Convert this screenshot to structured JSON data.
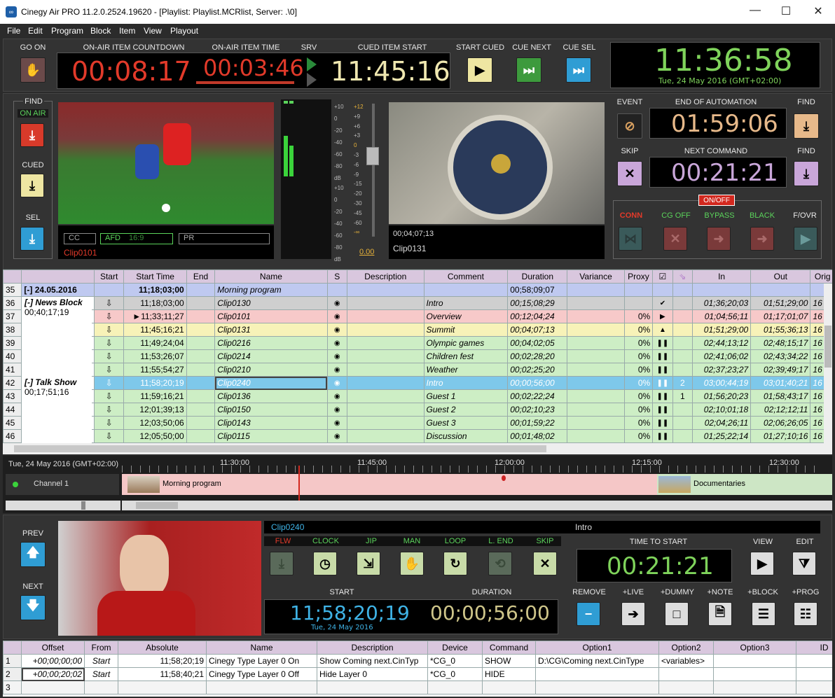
{
  "window": {
    "title": "Cinegy Air PRO 11.2.0.2524.19620 - [Playlist: Playlist.MCRlist, Server: .\\0]",
    "minimize": "—",
    "maximize": "☐",
    "close": "✕"
  },
  "menu": [
    "File",
    "Edit",
    "Program",
    "Block",
    "Item",
    "View",
    "Playout"
  ],
  "top": {
    "go_on": "GO ON",
    "countdown_label": "ON-AIR ITEM COUNTDOWN",
    "countdown": "00:08:17",
    "item_time_label": "ON-AIR ITEM TIME",
    "item_time": "00:03:46",
    "srv_label": "SRV",
    "cued_start_label": "CUED ITEM START",
    "cued_start": "11:45:16",
    "start_cued": "START CUED",
    "cue_next": "CUE NEXT",
    "cue_sel": "CUE SEL",
    "clock": "11:36:58",
    "date": "Tue, 24 May 2016 (GMT+02:00)"
  },
  "find": {
    "title": "FIND",
    "on_air": "ON AIR",
    "cued": "CUED",
    "sel": "SEL"
  },
  "preview": {
    "cc": "CC",
    "afd": "AFD",
    "afd_val": "16:9",
    "pr": "PR",
    "clip": "Clip0101"
  },
  "audio": {
    "scale": [
      "+10",
      "0",
      "-20",
      "-40",
      "-60",
      "-80",
      "dB"
    ],
    "scale2": [
      "+10",
      "0",
      "-20",
      "-40",
      "-60",
      "-80",
      "dB"
    ],
    "fader": [
      "+12",
      "+9",
      "+6",
      "+3",
      "0",
      "-3",
      "-6",
      "-9",
      "-15",
      "-20",
      "-30",
      "-45",
      "-60",
      "-∞"
    ],
    "gain": "0.00"
  },
  "program": {
    "tc": "00;04;07;13",
    "clip": "Clip0131"
  },
  "event": {
    "event_label": "EVENT",
    "eoa_label": "END OF AUTOMATION",
    "eoa": "01:59:06",
    "find1": "FIND",
    "skip_label": "SKIP",
    "next_cmd_label": "NEXT COMMAND",
    "next_cmd": "00:21:21",
    "find2": "FIND",
    "onoff": "ON/OFF",
    "conn": "CONN",
    "cgoff": "CG OFF",
    "bypass": "BYPASS",
    "black": "BLACK",
    "fovr": "F/OVR"
  },
  "playlist": {
    "headers": [
      "Start",
      "Start Time",
      "End",
      "Name",
      "S",
      "Description",
      "Comment",
      "Duration",
      "Variance",
      "Proxy",
      "☑",
      "⇘",
      "In",
      "Out",
      "Orig"
    ],
    "date_row": {
      "num": "35",
      "label": "[-] 24.05.2016",
      "start_time": "11;18;03;00",
      "name": "Morning program",
      "duration": "00;58;09;07"
    },
    "blocks": [
      {
        "title": "[-] News Block",
        "dur": "00;40;17;19"
      },
      {
        "title": "[-] Talk Show",
        "dur": "00;17;51;16"
      }
    ],
    "rows": [
      {
        "num": "36",
        "start": "⇩",
        "time": "11;18;03;00",
        "name": "Clip0130",
        "comment": "Intro",
        "dur": "00;15;08;29",
        "proxy": "",
        "flag": "✔",
        "n": "",
        "in": "01;36;20;03",
        "out": "01;51;29;00",
        "orig": "16",
        "bg": "#cfcfcf"
      },
      {
        "num": "37",
        "start": "⇩",
        "time": "►11;33;11;27",
        "name": "Clip0101",
        "comment": "Overview",
        "dur": "00;12;04;24",
        "proxy": "0%",
        "flag": "▶",
        "n": "",
        "in": "01;04;56;11",
        "out": "01;17;01;07",
        "orig": "16",
        "bg": "#f7c9c9"
      },
      {
        "num": "38",
        "start": "⇩",
        "time": "11;45;16;21",
        "name": "Clip0131",
        "comment": "Summit",
        "dur": "00;04;07;13",
        "proxy": "0%",
        "flag": "▲",
        "n": "",
        "in": "01;51;29;00",
        "out": "01;55;36;13",
        "orig": "16",
        "bg": "#f7f2b8"
      },
      {
        "num": "39",
        "start": "⇩",
        "time": "11;49;24;04",
        "name": "Clip0216",
        "comment": "Olympic games",
        "dur": "00;04;02;05",
        "proxy": "0%",
        "flag": "❚❚",
        "n": "",
        "in": "02;44;13;12",
        "out": "02;48;15;17",
        "orig": "16",
        "bg": "#cdeec5"
      },
      {
        "num": "40",
        "start": "⇩",
        "time": "11;53;26;07",
        "name": "Clip0214",
        "comment": "Children fest",
        "dur": "00;02;28;20",
        "proxy": "0%",
        "flag": "❚❚",
        "n": "",
        "in": "02;41;06;02",
        "out": "02;43;34;22",
        "orig": "16",
        "bg": "#cdeec5"
      },
      {
        "num": "41",
        "start": "⇩",
        "time": "11;55;54;27",
        "name": "Clip0210",
        "comment": "Weather",
        "dur": "00;02;25;20",
        "proxy": "0%",
        "flag": "❚❚",
        "n": "",
        "in": "02;37;23;27",
        "out": "02;39;49;17",
        "orig": "16",
        "bg": "#cdeec5"
      },
      {
        "num": "42",
        "start": "⇩",
        "time": "11;58;20;19",
        "name": "Clip0240",
        "comment": "Intro",
        "dur": "00;00;56;00",
        "proxy": "0%",
        "flag": "❚❚",
        "n": "2",
        "in": "03;00;44;19",
        "out": "03;01;40;21",
        "orig": "16",
        "bg": "#7ec8ea"
      },
      {
        "num": "43",
        "start": "⇩",
        "time": "11;59;16;21",
        "name": "Clip0136",
        "comment": "Guest 1",
        "dur": "00;02;22;24",
        "proxy": "0%",
        "flag": "❚❚",
        "n": "1",
        "in": "01;56;20;23",
        "out": "01;58;43;17",
        "orig": "16",
        "bg": "#cdeec5"
      },
      {
        "num": "44",
        "start": "⇩",
        "time": "12;01;39;13",
        "name": "Clip0150",
        "comment": "Guest 2",
        "dur": "00;02;10;23",
        "proxy": "0%",
        "flag": "❚❚",
        "n": "",
        "in": "02;10;01;18",
        "out": "02;12;12;11",
        "orig": "16",
        "bg": "#cdeec5"
      },
      {
        "num": "45",
        "start": "⇩",
        "time": "12;03;50;06",
        "name": "Clip0143",
        "comment": "Guest 3",
        "dur": "00;01;59;22",
        "proxy": "0%",
        "flag": "❚❚",
        "n": "",
        "in": "02;04;26;11",
        "out": "02;06;26;05",
        "orig": "16",
        "bg": "#cdeec5"
      },
      {
        "num": "46",
        "start": "⇩",
        "time": "12;05;50;00",
        "name": "Clip0115",
        "comment": "Discussion",
        "dur": "00;01;48;02",
        "proxy": "0%",
        "flag": "❚❚",
        "n": "",
        "in": "01;25;22;14",
        "out": "01;27;10;16",
        "orig": "16",
        "bg": "#cdeec5"
      }
    ]
  },
  "timeline": {
    "date": "Tue, 24 May 2016 (GMT+02:00)",
    "ticks": [
      "11:30:00",
      "11:45:00",
      "12:00:00",
      "12:15:00",
      "12:30:00"
    ],
    "channel": "Channel 1",
    "items": [
      "Morning program",
      "Documentaries"
    ]
  },
  "detail": {
    "prev": "PREV",
    "next": "NEXT",
    "clip": "Clip0240",
    "comment": "Intro",
    "flags": [
      "FLW",
      "CLOCK",
      "JIP",
      "MAN",
      "LOOP",
      "L. END",
      "SKIP"
    ],
    "time_to_start_label": "TIME TO START",
    "time_to_start": "00:21:21",
    "view": "VIEW",
    "edit": "EDIT",
    "start_label": "START",
    "start": "11;58;20;19",
    "start_date": "Tue, 24 May 2016",
    "duration_label": "DURATION",
    "duration": "00;00;56;00",
    "actions": [
      "REMOVE",
      "+LIVE",
      "+DUMMY",
      "+NOTE",
      "+BLOCK",
      "+PROG"
    ]
  },
  "commands": {
    "headers": [
      "",
      "Offset",
      "From",
      "Absolute",
      "Name",
      "Description",
      "Device",
      "Command",
      "Option1",
      "Option2",
      "Option3",
      "ID"
    ],
    "rows": [
      [
        "1",
        "+00;00;00;00",
        "Start",
        "11;58;20;19",
        "Cinegy Type Layer 0 On",
        "Show Coming next.CinTyp",
        "*CG_0",
        "SHOW",
        "D:\\CG\\Coming next.CinType",
        "<variables>",
        "",
        ""
      ],
      [
        "2",
        "+00;00;20;02",
        "Start",
        "11;58;40;21",
        "Cinegy Type Layer 0 Off",
        "Hide Layer 0",
        "*CG_0",
        "HIDE",
        "",
        "",
        "",
        ""
      ],
      [
        "3",
        "",
        "",
        "",
        "",
        "",
        "",
        "",
        "",
        "",
        "",
        ""
      ]
    ]
  },
  "colors": {
    "red_digits": "#e23a2a",
    "cream_digits": "#efe7b0",
    "green_digits": "#7fd35b",
    "peach_digits": "#e7b98a",
    "violet_digits": "#c9a6d9",
    "blue_digits": "#3fb3e6",
    "olive_digits": "#cfc68a"
  }
}
